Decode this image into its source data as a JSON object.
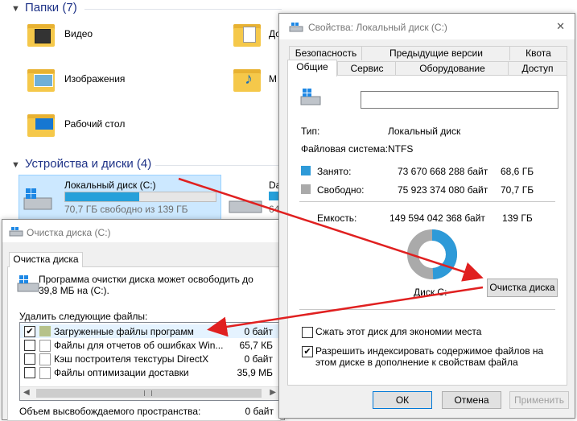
{
  "explorer": {
    "folders_header": "Папки (7)",
    "folders": [
      {
        "label": "Видео"
      },
      {
        "label": "Изображения"
      },
      {
        "label": "Рабочий стол"
      },
      {
        "label": "До"
      },
      {
        "label": "М"
      }
    ],
    "devices_header": "Устройства и диски (4)",
    "drive_c": {
      "name": "Локальный диск (C:)",
      "free_text": "70,7 ГБ свободно из 139 ГБ",
      "used_fraction": 0.49
    },
    "drive_d": {
      "name": "Da",
      "free_text": "64"
    }
  },
  "properties": {
    "title": "Свойства: Локальный диск (C:)",
    "close_glyph": "✕",
    "tabs_row1": [
      "Безопасность",
      "Предыдущие версии",
      "Квота"
    ],
    "tabs_row2": [
      "Общие",
      "Сервис",
      "Оборудование",
      "Доступ"
    ],
    "active_tab": "Общие",
    "name_value": "",
    "type_label": "Тип:",
    "type_value": "Локальный диск",
    "fs_label": "Файловая система:",
    "fs_value": "NTFS",
    "used_label": "Занято:",
    "used_bytes": "73 670 668 288 байт",
    "used_gb": "68,6 ГБ",
    "free_label": "Свободно:",
    "free_bytes": "75 923 374 080 байт",
    "free_gb": "70,7 ГБ",
    "capacity_label": "Емкость:",
    "capacity_bytes": "149 594 042 368 байт",
    "capacity_gb": "139 ГБ",
    "used_fraction": 0.4925,
    "used_color": "#2e9ad8",
    "free_color": "#aaaaaa",
    "disk_label": "Диск C:",
    "cleanup_button": "Очистка диска",
    "compress_label": "Сжать этот диск для экономии места",
    "compress_checked": false,
    "index_label": "Разрешить индексировать содержимое файлов на этом диске в дополнение к свойствам файла",
    "index_checked": true,
    "ok_button": "ОК",
    "cancel_button": "Отмена",
    "apply_button": "Применить"
  },
  "cleanup": {
    "title": "Очистка диска  (C:)",
    "tab": "Очистка диска",
    "description": "Программа очистки диска может освободить до 39,8 МБ на  (C:).",
    "delete_label": "Удалить следующие файлы:",
    "files": [
      {
        "name": "Загруженные файлы программ",
        "size": "0 байт",
        "checked": true
      },
      {
        "name": "Файлы для отчетов об ошибках Win...",
        "size": "65,7 КБ",
        "checked": false
      },
      {
        "name": "Кэш построителя текстуры DirectX",
        "size": "0 байт",
        "checked": false
      },
      {
        "name": "Файлы оптимизации доставки",
        "size": "35,9 МБ",
        "checked": false
      }
    ],
    "total_label": "Объем высвобождаемого пространства:",
    "total_value": "0 байт"
  },
  "arrow_color": "#e02020"
}
